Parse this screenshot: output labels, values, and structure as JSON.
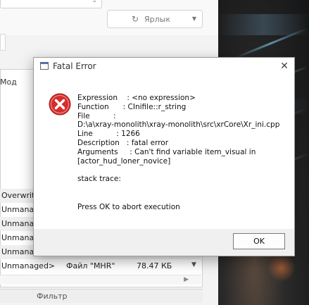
{
  "background_app": {
    "shortcut_button_label": "Ярлык",
    "column_header": "Мод",
    "rows": [
      {
        "c1": "Overwrite",
        "c2": "",
        "c3": "",
        "shade": true
      },
      {
        "c1": "Unmana",
        "c2": "",
        "c3": "",
        "shade": false
      },
      {
        "c1": "Unmana",
        "c2": "",
        "c3": "",
        "shade": true
      },
      {
        "c1": "Unmana",
        "c2": "",
        "c3": "",
        "shade": false
      },
      {
        "c1": "Unmana",
        "c2": "",
        "c3": "",
        "shade": true
      },
      {
        "c1": "Unmanaged>",
        "c2": "Файл \"MHR\"",
        "c3": "78.47 КБ",
        "shade": false
      }
    ],
    "filter_label": "Фильтр"
  },
  "dialog": {
    "title": "Fatal Error",
    "icon": "error-icon",
    "message_lines": [
      "Expression    : <no expression>",
      "Function      : CInifile::r_string",
      "File          :",
      "D:\\a\\xray-monolith\\xray-monolith\\src\\xrCore\\Xr_ini.cpp",
      "Line          : 1266",
      "Description   : fatal error",
      "Arguments     : Can't find variable item_visual in",
      "[actor_hud_loner_novice]"
    ],
    "stack_trace_label": "stack trace:",
    "abort_text": "Press OK to abort execution",
    "ok_label": "OK"
  },
  "colors": {
    "error_red": "#d62d2d",
    "dialog_footer": "#f0f0f0"
  }
}
